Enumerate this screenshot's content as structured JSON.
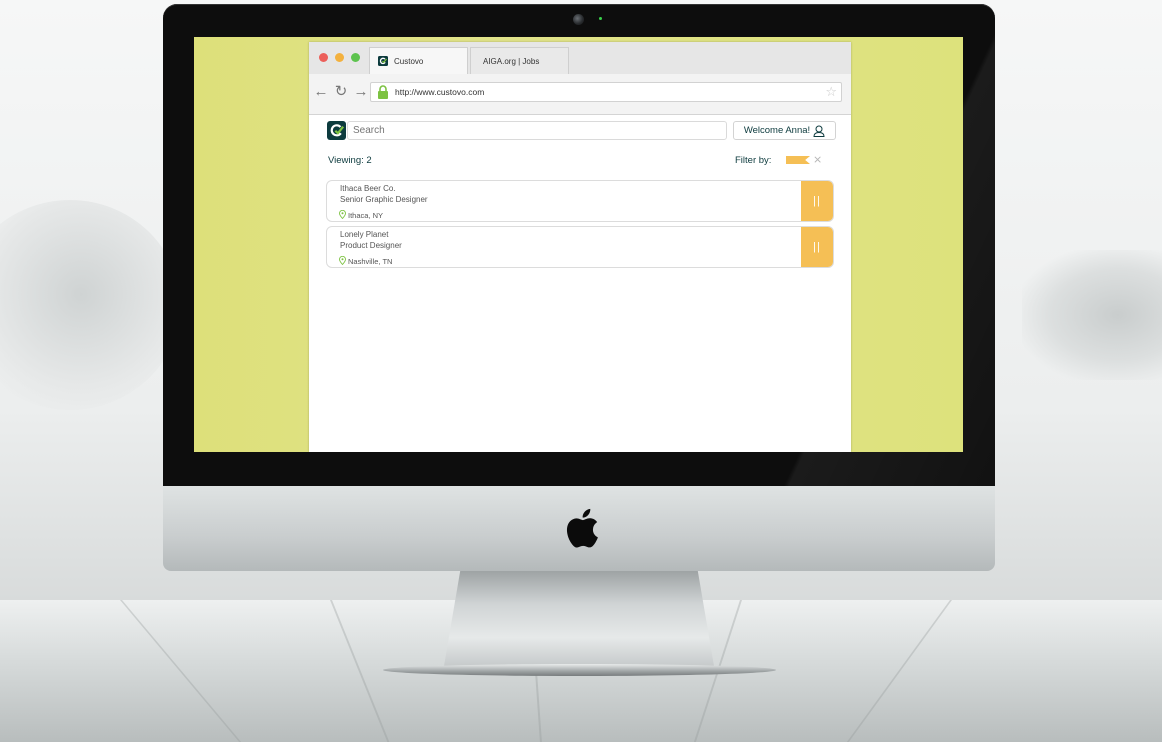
{
  "browser": {
    "tabs": [
      {
        "label": "Custovo",
        "active": true
      },
      {
        "label": "AIGA.org | Jobs",
        "active": false
      }
    ],
    "url": "http://www.custovo.com"
  },
  "header": {
    "search_placeholder": "Search",
    "welcome_label": "Welcome Anna!"
  },
  "list_bar": {
    "viewing_label": "Viewing: 2",
    "filter_label": "Filter by:"
  },
  "jobs": [
    {
      "company": "Ithaca Beer Co.",
      "title": "Senior Graphic Designer",
      "location": "Ithaca, NY"
    },
    {
      "company": "Lonely Planet",
      "title": "Product Designer",
      "location": "Nashville, TN"
    }
  ],
  "colors": {
    "screen_background": "#dde07a",
    "accent": "#f5bf55",
    "brand_dark": "#0d3b3e",
    "brand_green": "#7dc242"
  },
  "icons": [
    "close-window-icon",
    "minimize-window-icon",
    "zoom-window-icon",
    "back-arrow-icon",
    "reload-icon",
    "forward-arrow-icon",
    "lock-icon",
    "bookmark-star-icon",
    "custovo-logo-icon",
    "user-icon",
    "close-icon",
    "location-pin-icon",
    "drag-handle-icon",
    "apple-logo"
  ]
}
